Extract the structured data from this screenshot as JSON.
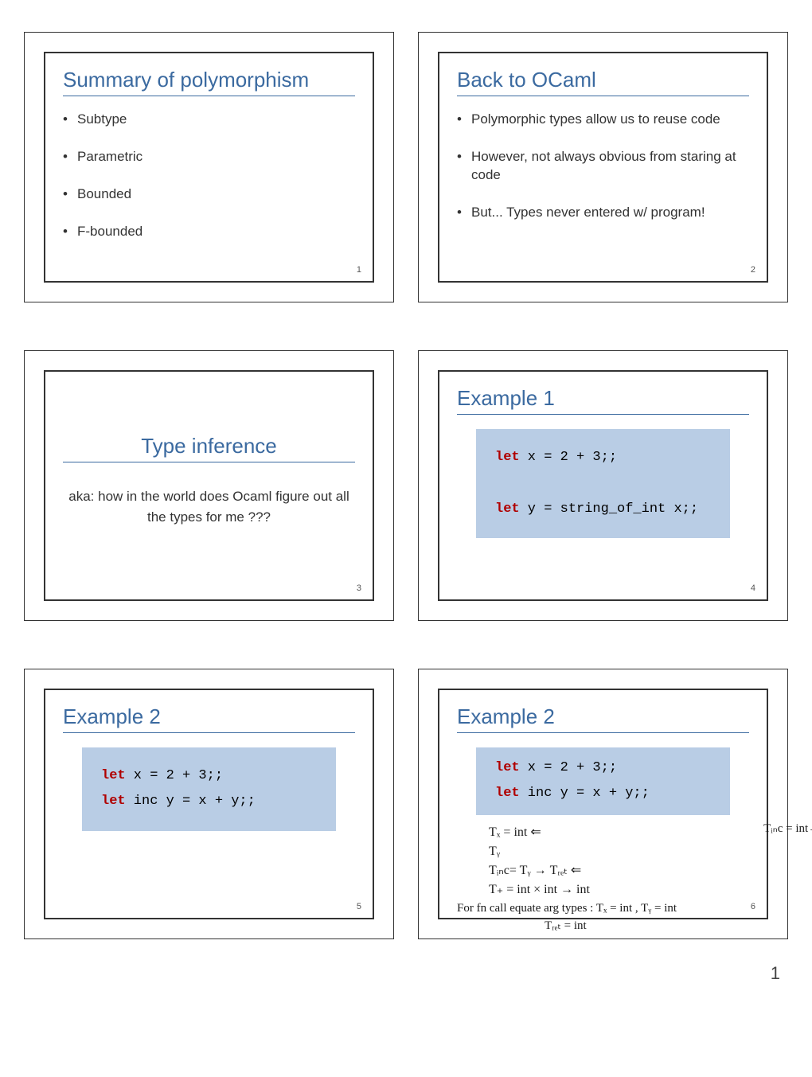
{
  "slides": [
    {
      "num": "1",
      "title": "Summary of polymorphism",
      "bullets": [
        "Subtype",
        "Parametric",
        "Bounded",
        "F-bounded"
      ]
    },
    {
      "num": "2",
      "title": "Back to OCaml",
      "bullets": [
        "Polymorphic types allow us to reuse code",
        "However, not always obvious from staring at code",
        "But... Types never entered w/ program!"
      ]
    },
    {
      "num": "3",
      "title_centered": "Type inference",
      "subtext": "aka: how in the world does Ocaml figure out all the types for me ???"
    },
    {
      "num": "4",
      "title": "Example 1",
      "code_lines": [
        {
          "kw": "let",
          "rest": " x = 2 + 3;;"
        },
        {
          "kw": "",
          "rest": ""
        },
        {
          "kw": "let",
          "rest": " y = string_of_int x;;"
        }
      ]
    },
    {
      "num": "5",
      "title": "Example 2",
      "code_lines": [
        {
          "kw": "let",
          "rest": " x = 2 + 3;;"
        },
        {
          "kw": "let",
          "rest": " inc y = x + y;;"
        }
      ]
    },
    {
      "num": "6",
      "title": "Example 2",
      "code_lines": [
        {
          "kw": "let",
          "rest": " x = 2 + 3;;"
        },
        {
          "kw": "let",
          "rest": " inc y = x + y;;"
        }
      ],
      "handwriting": {
        "l1": "Tₓ = int ⇐",
        "tinc_right": "Tᵢₙc = int→int",
        "l2": "Tᵧ",
        "l3": "Tᵢₙc= Tᵧ → Tᵣₑₜ ⇐",
        "l4": "T₊ = int × int → int",
        "l5": "For fn call equate arg types : Tₓ = int , Tᵧ = int",
        "l6": "Tᵣₑₜ = int"
      }
    }
  ],
  "page_number": "1"
}
